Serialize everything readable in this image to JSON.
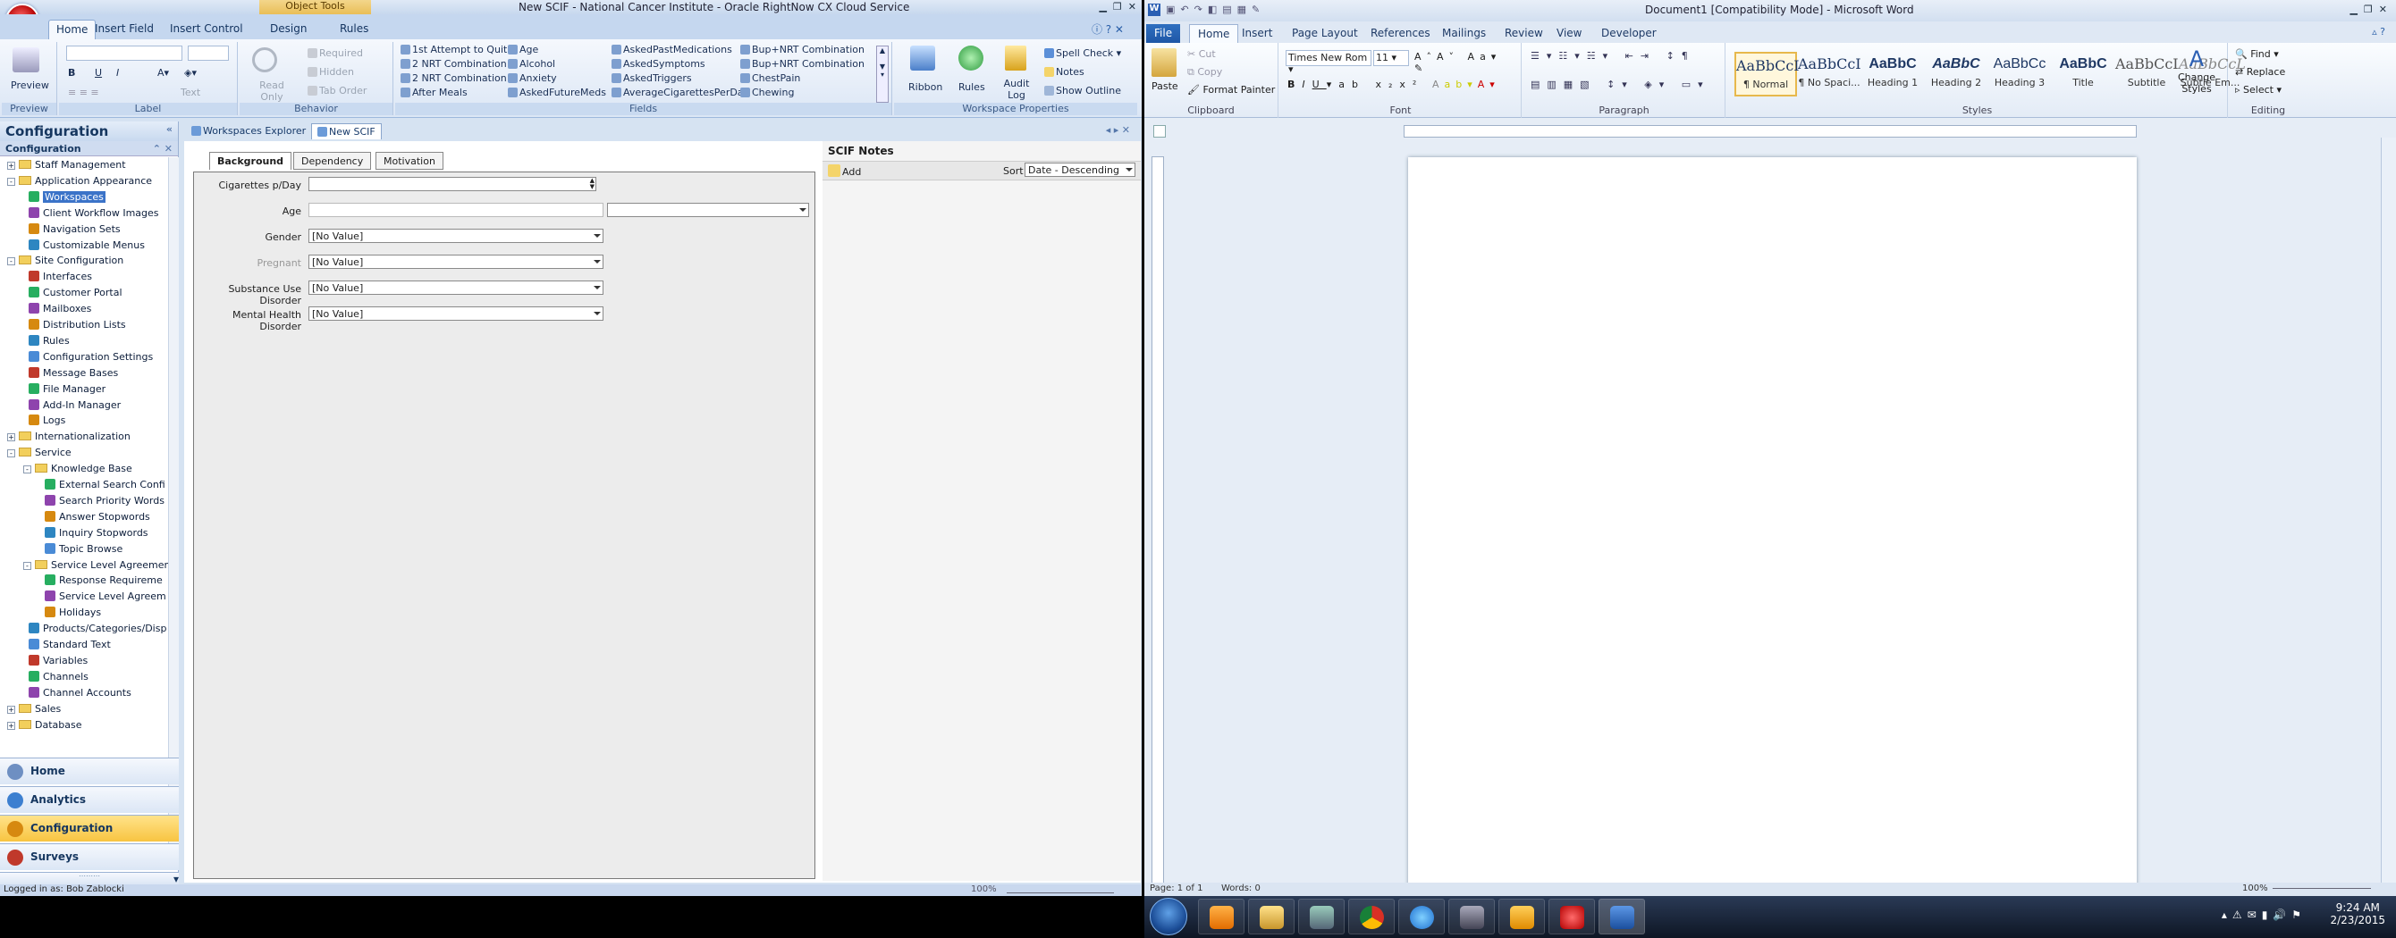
{
  "rn": {
    "title": "New SCIF - National Cancer Institute - Oracle RightNow CX Cloud Service",
    "context_tab": "Object Tools",
    "tabs": [
      "Home",
      "Insert Field",
      "Insert Control",
      "Design",
      "Rules"
    ],
    "ribbon": {
      "preview": "Preview",
      "read_only": "Read Only",
      "required": "Required",
      "hidden": "Hidden",
      "tab_order": "Tab Order",
      "text_label": "Text",
      "fields": [
        "1st Attempt to Quit",
        "2 NRT Combination",
        "2 NRT Combination",
        "After Meals",
        "Age",
        "Alcohol",
        "Anxiety",
        "AskedFutureMeds",
        "AskedPastMedications",
        "AskedSymptoms",
        "AskedTriggers",
        "AverageCigarettesPerDay",
        "Bup+NRT Combination",
        "Bup+NRT Combination",
        "ChestPain",
        "Chewing"
      ],
      "ribbon_btn": "Ribbon",
      "rules_btn": "Rules",
      "audit_log": "Audit Log",
      "spell_check": "Spell Check",
      "notes": "Notes",
      "show_outline": "Show Outline",
      "groups": [
        "Preview",
        "Label",
        "Behavior",
        "Fields",
        "Workspace Properties"
      ]
    },
    "nav": {
      "header": "Configuration",
      "subheader": "Configuration",
      "tree": [
        {
          "label": "Staff Management",
          "depth": 0,
          "type": "folder",
          "exp": "+"
        },
        {
          "label": "Application Appearance",
          "depth": 0,
          "type": "folder",
          "exp": "-"
        },
        {
          "label": "Workspaces",
          "depth": 1,
          "type": "item",
          "selected": true
        },
        {
          "label": "Client Workflow Images",
          "depth": 1,
          "type": "item"
        },
        {
          "label": "Navigation Sets",
          "depth": 1,
          "type": "item"
        },
        {
          "label": "Customizable Menus",
          "depth": 1,
          "type": "item"
        },
        {
          "label": "Site Configuration",
          "depth": 0,
          "type": "folder",
          "exp": "-"
        },
        {
          "label": "Interfaces",
          "depth": 1,
          "type": "item"
        },
        {
          "label": "Customer Portal",
          "depth": 1,
          "type": "item"
        },
        {
          "label": "Mailboxes",
          "depth": 1,
          "type": "item"
        },
        {
          "label": "Distribution Lists",
          "depth": 1,
          "type": "item"
        },
        {
          "label": "Rules",
          "depth": 1,
          "type": "item"
        },
        {
          "label": "Configuration Settings",
          "depth": 1,
          "type": "item"
        },
        {
          "label": "Message Bases",
          "depth": 1,
          "type": "item"
        },
        {
          "label": "File Manager",
          "depth": 1,
          "type": "item"
        },
        {
          "label": "Add-In Manager",
          "depth": 1,
          "type": "item"
        },
        {
          "label": "Logs",
          "depth": 1,
          "type": "item"
        },
        {
          "label": "Internationalization",
          "depth": 0,
          "type": "folder",
          "exp": "+"
        },
        {
          "label": "Service",
          "depth": 0,
          "type": "folder",
          "exp": "-"
        },
        {
          "label": "Knowledge Base",
          "depth": 1,
          "type": "folder",
          "exp": "-"
        },
        {
          "label": "External Search Confi",
          "depth": 2,
          "type": "item"
        },
        {
          "label": "Search Priority Words",
          "depth": 2,
          "type": "item"
        },
        {
          "label": "Answer Stopwords",
          "depth": 2,
          "type": "item"
        },
        {
          "label": "Inquiry Stopwords",
          "depth": 2,
          "type": "item"
        },
        {
          "label": "Topic Browse",
          "depth": 2,
          "type": "item"
        },
        {
          "label": "Service Level Agreements",
          "depth": 1,
          "type": "folder",
          "exp": "-"
        },
        {
          "label": "Response Requireme",
          "depth": 2,
          "type": "item"
        },
        {
          "label": "Service Level Agreem",
          "depth": 2,
          "type": "item"
        },
        {
          "label": "Holidays",
          "depth": 2,
          "type": "item"
        },
        {
          "label": "Products/Categories/Disp",
          "depth": 1,
          "type": "item"
        },
        {
          "label": "Standard Text",
          "depth": 1,
          "type": "item"
        },
        {
          "label": "Variables",
          "depth": 1,
          "type": "item"
        },
        {
          "label": "Channels",
          "depth": 1,
          "type": "item"
        },
        {
          "label": "Channel Accounts",
          "depth": 1,
          "type": "item"
        },
        {
          "label": "Sales",
          "depth": 0,
          "type": "folder",
          "exp": "+"
        },
        {
          "label": "Database",
          "depth": 0,
          "type": "folder",
          "exp": "+"
        }
      ],
      "buttons": [
        "Home",
        "Analytics",
        "Configuration",
        "Surveys"
      ],
      "status": "Logged in as: Bob Zablocki"
    },
    "workspace_tabs": [
      "Workspaces Explorer",
      "New SCIF"
    ],
    "form": {
      "tabs": [
        "Background",
        "Dependency",
        "Motivation"
      ],
      "fields": [
        {
          "label": "Cigarettes p/Day",
          "value": ""
        },
        {
          "label": "Age",
          "value": ""
        },
        {
          "label": "Gender",
          "value": "[No Value]"
        },
        {
          "label": "Pregnant",
          "value": "[No Value]"
        },
        {
          "label": "Substance Use Disorder",
          "value": "[No Value]"
        },
        {
          "label": "Mental Health Disorder",
          "value": "[No Value]"
        }
      ]
    },
    "notes": {
      "header": "SCIF Notes",
      "add": "Add",
      "sort_label": "Sort",
      "sort_value": "Date - Descending"
    },
    "zoom": "100%"
  },
  "word": {
    "title": "Document1 [Compatibility Mode] - Microsoft Word",
    "tabs": [
      "File",
      "Home",
      "Insert",
      "Page Layout",
      "References",
      "Mailings",
      "Review",
      "View",
      "Developer"
    ],
    "clipboard": {
      "paste": "Paste",
      "cut": "Cut",
      "copy": "Copy",
      "format_painter": "Format Painter",
      "label": "Clipboard"
    },
    "font": {
      "name": "Times New Rom",
      "size": "11",
      "label": "Font"
    },
    "paragraph_label": "Paragraph",
    "styles": [
      {
        "preview": "AaBbCcI",
        "name": "¶ Normal"
      },
      {
        "preview": "AaBbCcI",
        "name": "¶ No Spaci..."
      },
      {
        "preview": "AaBbC",
        "name": "Heading 1"
      },
      {
        "preview": "AaBbC",
        "name": "Heading 2"
      },
      {
        "preview": "AaBbCc",
        "name": "Heading 3"
      },
      {
        "preview": "AaBbC",
        "name": "Title"
      },
      {
        "preview": "AaBbCcI",
        "name": "Subtitle"
      },
      {
        "preview": "AaBbCcL",
        "name": "Subtle Em..."
      }
    ],
    "styles_label": "Styles",
    "change_styles": "Change Styles",
    "editing": {
      "find": "Find",
      "replace": "Replace",
      "select": "Select",
      "label": "Editing"
    },
    "status": {
      "page": "Page: 1 of 1",
      "words": "Words: 0",
      "zoom": "100%"
    }
  },
  "taskbar": {
    "time": "9:24 AM",
    "date": "2/23/2015"
  }
}
